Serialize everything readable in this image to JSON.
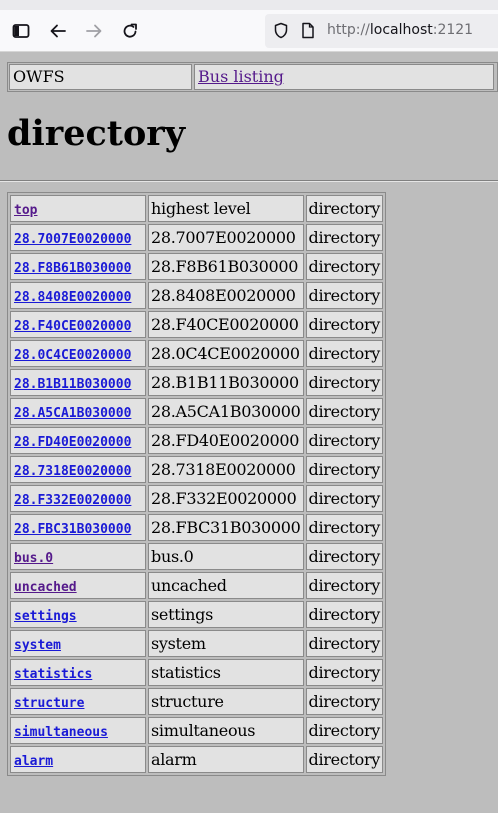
{
  "browser": {
    "url_protocol": "http://",
    "url_host": "localhost",
    "url_port": ":2121"
  },
  "nav": {
    "owfs_label": "OWFS",
    "bus_listing_label": "Bus listing"
  },
  "page_title": "directory",
  "rows": [
    {
      "name": "top",
      "desc": "highest level",
      "type": "directory",
      "visited": true
    },
    {
      "name": "28.7007E0020000",
      "desc": "28.7007E0020000",
      "type": "directory",
      "visited": false
    },
    {
      "name": "28.F8B61B030000",
      "desc": "28.F8B61B030000",
      "type": "directory",
      "visited": false
    },
    {
      "name": "28.8408E0020000",
      "desc": "28.8408E0020000",
      "type": "directory",
      "visited": false
    },
    {
      "name": "28.F40CE0020000",
      "desc": "28.F40CE0020000",
      "type": "directory",
      "visited": false
    },
    {
      "name": "28.0C4CE0020000",
      "desc": "28.0C4CE0020000",
      "type": "directory",
      "visited": false
    },
    {
      "name": "28.B1B11B030000",
      "desc": "28.B1B11B030000",
      "type": "directory",
      "visited": false
    },
    {
      "name": "28.A5CA1B030000",
      "desc": "28.A5CA1B030000",
      "type": "directory",
      "visited": false
    },
    {
      "name": "28.FD40E0020000",
      "desc": "28.FD40E0020000",
      "type": "directory",
      "visited": false
    },
    {
      "name": "28.7318E0020000",
      "desc": "28.7318E0020000",
      "type": "directory",
      "visited": false
    },
    {
      "name": "28.F332E0020000",
      "desc": "28.F332E0020000",
      "type": "directory",
      "visited": false
    },
    {
      "name": "28.FBC31B030000",
      "desc": "28.FBC31B030000",
      "type": "directory",
      "visited": false
    },
    {
      "name": "bus.0",
      "desc": "bus.0",
      "type": "directory",
      "visited": true
    },
    {
      "name": "uncached",
      "desc": "uncached",
      "type": "directory",
      "visited": true
    },
    {
      "name": "settings",
      "desc": "settings",
      "type": "directory",
      "visited": false
    },
    {
      "name": "system",
      "desc": "system",
      "type": "directory",
      "visited": false
    },
    {
      "name": "statistics",
      "desc": "statistics",
      "type": "directory",
      "visited": false
    },
    {
      "name": "structure",
      "desc": "structure",
      "type": "directory",
      "visited": false
    },
    {
      "name": "simultaneous",
      "desc": "simultaneous",
      "type": "directory",
      "visited": false
    },
    {
      "name": "alarm",
      "desc": "alarm",
      "type": "directory",
      "visited": false
    }
  ]
}
